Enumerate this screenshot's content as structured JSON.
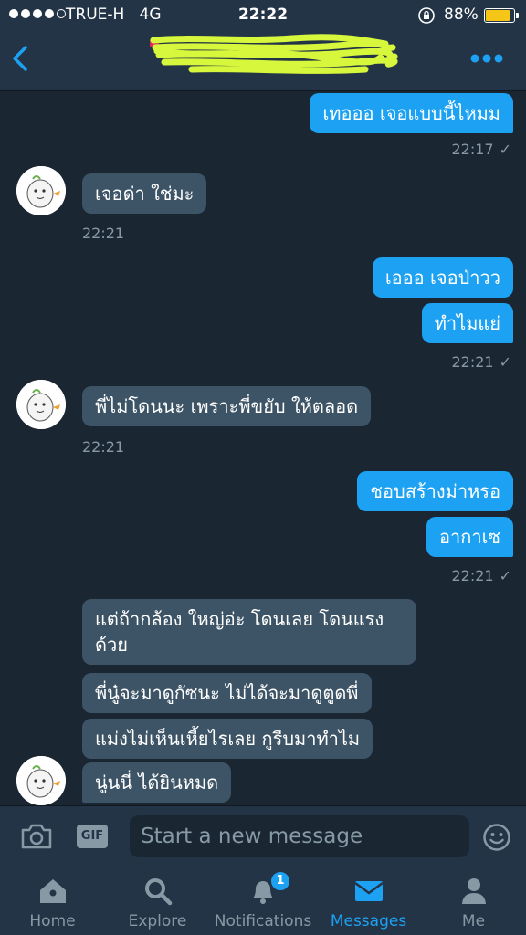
{
  "status_bar": {
    "carrier": "TRUE-H   4G",
    "time": "22:22",
    "battery": "88%",
    "battery_level": 0.88
  },
  "header": {
    "back_icon": "chevron-left-icon",
    "more_icon": "more-dots-icon",
    "accent_color": "#1da1f2"
  },
  "messages": [
    {
      "side": "me",
      "text": "เทอออ เจอแบบนี้ไหมม"
    },
    {
      "side": "me",
      "time": "22:17"
    },
    {
      "side": "them",
      "text": "เจอด่า ใช่มะ"
    },
    {
      "side": "them",
      "time": "22:21"
    },
    {
      "side": "me",
      "text": "เอออ เจอป่าวว"
    },
    {
      "side": "me",
      "text": "ทำไมแย่"
    },
    {
      "side": "me",
      "time": "22:21"
    },
    {
      "side": "them",
      "text": "พี่ไม่โดนนะ เพราะพี่ขยับ ให้ตลอด"
    },
    {
      "side": "them",
      "time": "22:21"
    },
    {
      "side": "me",
      "text": "ชอบสร้างม่าหรอ"
    },
    {
      "side": "me",
      "text": "อากาเซ"
    },
    {
      "side": "me",
      "time": "22:21"
    },
    {
      "side": "them",
      "text_line1": "แต่ถ้ากล้อง ใหญ่อ่ะ โดนเลย โดนแรง",
      "text_line2": "ด้วย"
    },
    {
      "side": "them",
      "text": "พี่นู๋จะมาดูกัซนะ ไม่ได้จะมาดูตูดพี่"
    },
    {
      "side": "them",
      "text": "แม่งไม่เห็นเหี้ยไรเลย กูรีบมาทำไม"
    },
    {
      "side": "them",
      "text": "นู่นนี่ ได้ยินหมด"
    }
  ],
  "composer": {
    "placeholder": "Start a new message",
    "gif_label": "GIF"
  },
  "tabs": [
    {
      "label": "Home",
      "icon": "home-icon"
    },
    {
      "label": "Explore",
      "icon": "search-icon"
    },
    {
      "label": "Notifications",
      "icon": "bell-icon",
      "badge": "1"
    },
    {
      "label": "Messages",
      "icon": "envelope-icon",
      "active": true
    },
    {
      "label": "Me",
      "icon": "person-icon"
    }
  ]
}
